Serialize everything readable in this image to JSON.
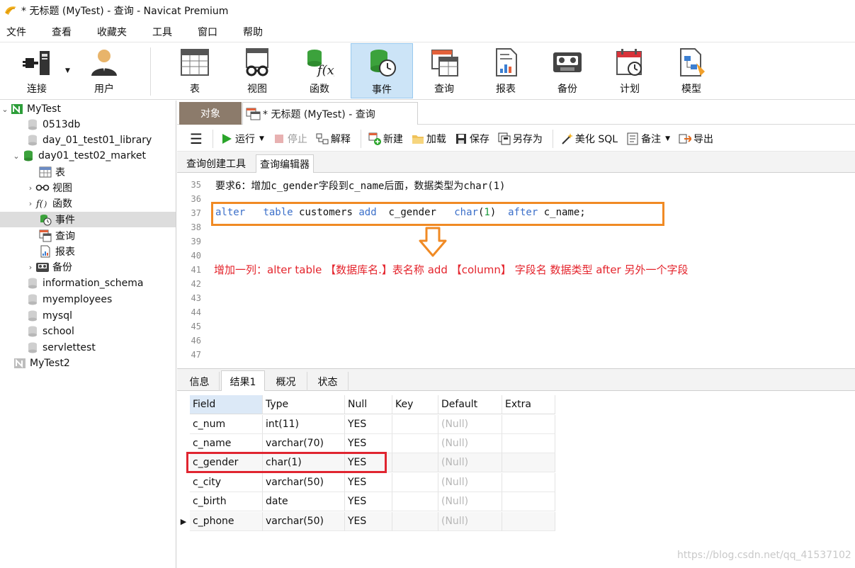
{
  "window": {
    "title": "* 无标题 (MyTest) - 查询 - Navicat Premium"
  },
  "menu": [
    "文件",
    "查看",
    "收藏夹",
    "工具",
    "窗口",
    "帮助"
  ],
  "toolbar": {
    "connect": "连接",
    "user": "用户",
    "table": "表",
    "view": "视图",
    "function": "函数",
    "event": "事件",
    "query": "查询",
    "report": "报表",
    "backup": "备份",
    "schedule": "计划",
    "model": "模型"
  },
  "tree": {
    "conn1": "MyTest",
    "db_0513": "0513db",
    "db_lib": "day_01_test01_library",
    "db_market": "day01_test02_market",
    "tables": "表",
    "views": "视图",
    "functions": "函数",
    "events": "事件",
    "queries": "查询",
    "reports": "报表",
    "backups": "备份",
    "db_info": "information_schema",
    "db_emp": "myemployees",
    "db_mysql": "mysql",
    "db_school": "school",
    "db_servlet": "servlettest",
    "conn2": "MyTest2"
  },
  "tabs": {
    "objects": "对象",
    "query": "* 无标题 (MyTest) - 查询"
  },
  "query_toolbar": {
    "run": "运行",
    "stop": "停止",
    "explain": "解释",
    "new": "新建",
    "load": "加载",
    "save": "保存",
    "save_as": "另存为",
    "beautify": "美化 SQL",
    "note": "备注",
    "export": "导出"
  },
  "editor_tabs": {
    "builder": "查询创建工具",
    "editor": "查询编辑器"
  },
  "editor": {
    "line_numbers": [
      "35",
      "36",
      "37",
      "38",
      "39",
      "40",
      "41",
      "42",
      "43",
      "44",
      "45",
      "46",
      "47"
    ],
    "comment_line": "要求6：增加c_gender字段到c_name后面，数据类型为char(1)",
    "sql": {
      "kw_alter": "alter",
      "kw_table": "table",
      "t_customers": "customers",
      "kw_add": "add",
      "t_col": "c_gender",
      "kw_char": "char",
      "paren_open": "(",
      "num_1": "1",
      "paren_close": ")",
      "kw_after": "after",
      "t_after_col": "c_name;"
    },
    "note": "增加一列：alter table 【数据库名.】表名称   add 【column】  字段名   数据类型   after   另外一个字段"
  },
  "result_tabs": {
    "info": "信息",
    "result1": "结果1",
    "overview": "概况",
    "status": "状态"
  },
  "result": {
    "columns": [
      "Field",
      "Type",
      "Null",
      "Key",
      "Default",
      "Extra"
    ],
    "rows": [
      {
        "field": "c_num",
        "type": "int(11)",
        "null": "YES",
        "key": "",
        "default": "(Null)",
        "extra": ""
      },
      {
        "field": "c_name",
        "type": "varchar(70)",
        "null": "YES",
        "key": "",
        "default": "(Null)",
        "extra": ""
      },
      {
        "field": "c_gender",
        "type": "char(1)",
        "null": "YES",
        "key": "",
        "default": "(Null)",
        "extra": ""
      },
      {
        "field": "c_city",
        "type": "varchar(50)",
        "null": "YES",
        "key": "",
        "default": "(Null)",
        "extra": ""
      },
      {
        "field": "c_birth",
        "type": "date",
        "null": "YES",
        "key": "",
        "default": "(Null)",
        "extra": ""
      },
      {
        "field": "c_phone",
        "type": "varchar(50)",
        "null": "YES",
        "key": "",
        "default": "(Null)",
        "extra": ""
      }
    ]
  },
  "watermark": "https://blog.csdn.net/qq_41537102"
}
